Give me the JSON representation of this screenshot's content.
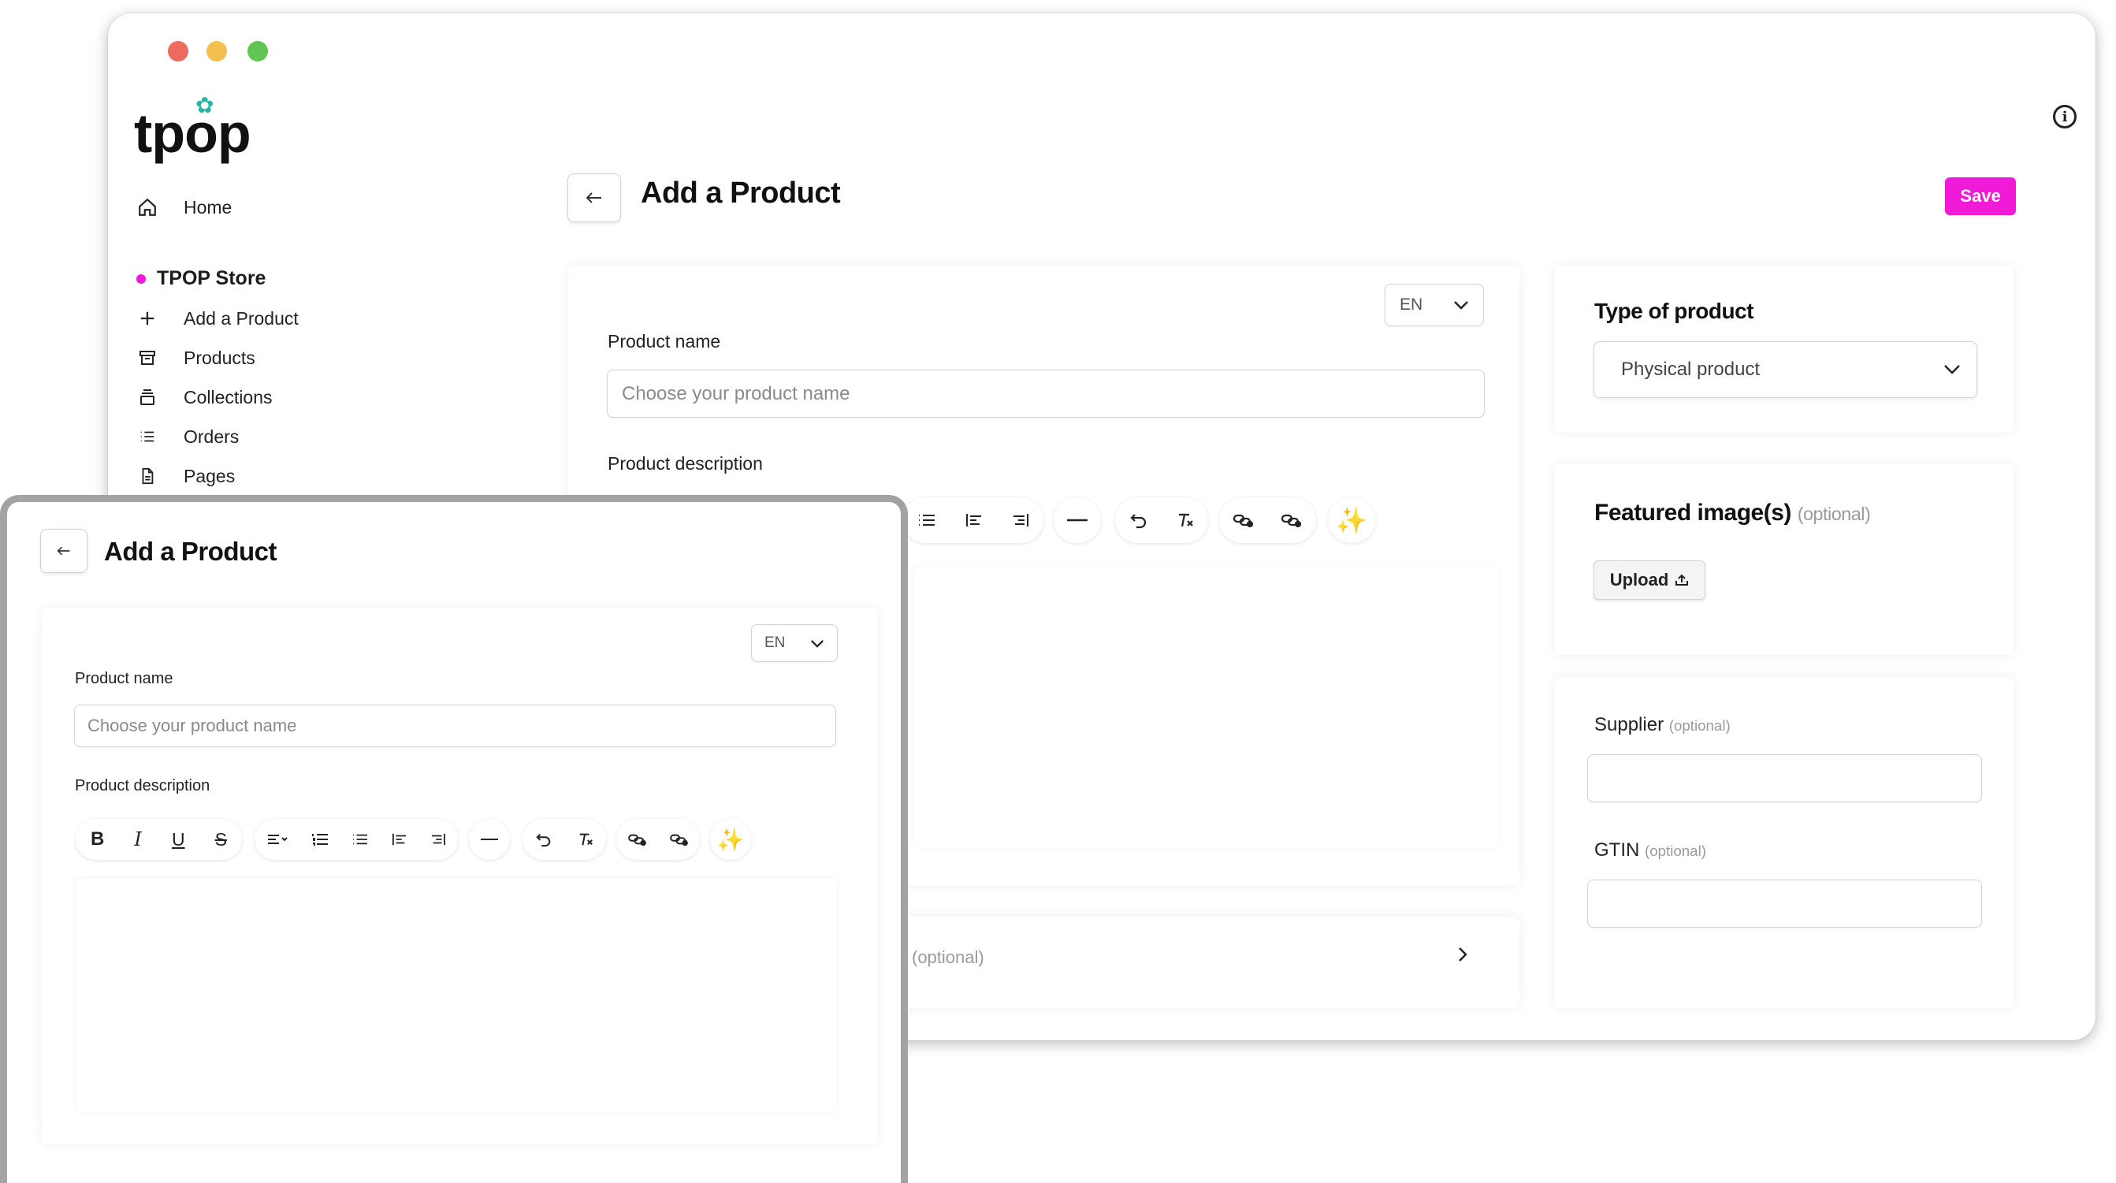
{
  "window": {
    "dots": [
      "#ec6a5e",
      "#f4bf4f",
      "#61c554"
    ]
  },
  "brand": {
    "logo": "tpop"
  },
  "sidebar": {
    "home": "Home",
    "store": "TPOP Store",
    "items": [
      {
        "label": "Add a Product",
        "icon": "plus-icon"
      },
      {
        "label": "Products",
        "icon": "archive-box-icon"
      },
      {
        "label": "Collections",
        "icon": "stack-icon"
      },
      {
        "label": "Orders",
        "icon": "list-icon"
      },
      {
        "label": "Pages",
        "icon": "document-icon"
      }
    ]
  },
  "header": {
    "title": "Add a Product",
    "save": "Save",
    "info_icon": "info-icon",
    "back_icon": "arrow-left-icon"
  },
  "form": {
    "lang": "EN",
    "product_name_label": "Product name",
    "product_name_placeholder": "Choose your product name",
    "description_label": "Product description",
    "collapsed_optional": "(optional)"
  },
  "sidecards": {
    "type_title": "Type of product",
    "type_value": "Physical product",
    "featured_title": "Featured image(s)",
    "featured_optional": "(optional)",
    "upload": "Upload",
    "supplier_label": "Supplier",
    "supplier_optional": "(optional)",
    "gtin_label": "GTIN",
    "gtin_optional": "(optional)"
  },
  "toolbar_icons": [
    "bold-icon",
    "italic-icon",
    "underline-icon",
    "strikethrough-icon",
    "align-icon",
    "ordered-list-icon",
    "bullet-list-icon",
    "indent-icon",
    "outdent-icon",
    "horizontal-rule-icon",
    "undo-icon",
    "clear-format-icon",
    "link-icon",
    "unlink-icon",
    "ai-sparkle-icon"
  ],
  "colors": {
    "accent": "#f11ad6",
    "leaf": "#2ab3a5",
    "sparkle": "#f6b625"
  }
}
